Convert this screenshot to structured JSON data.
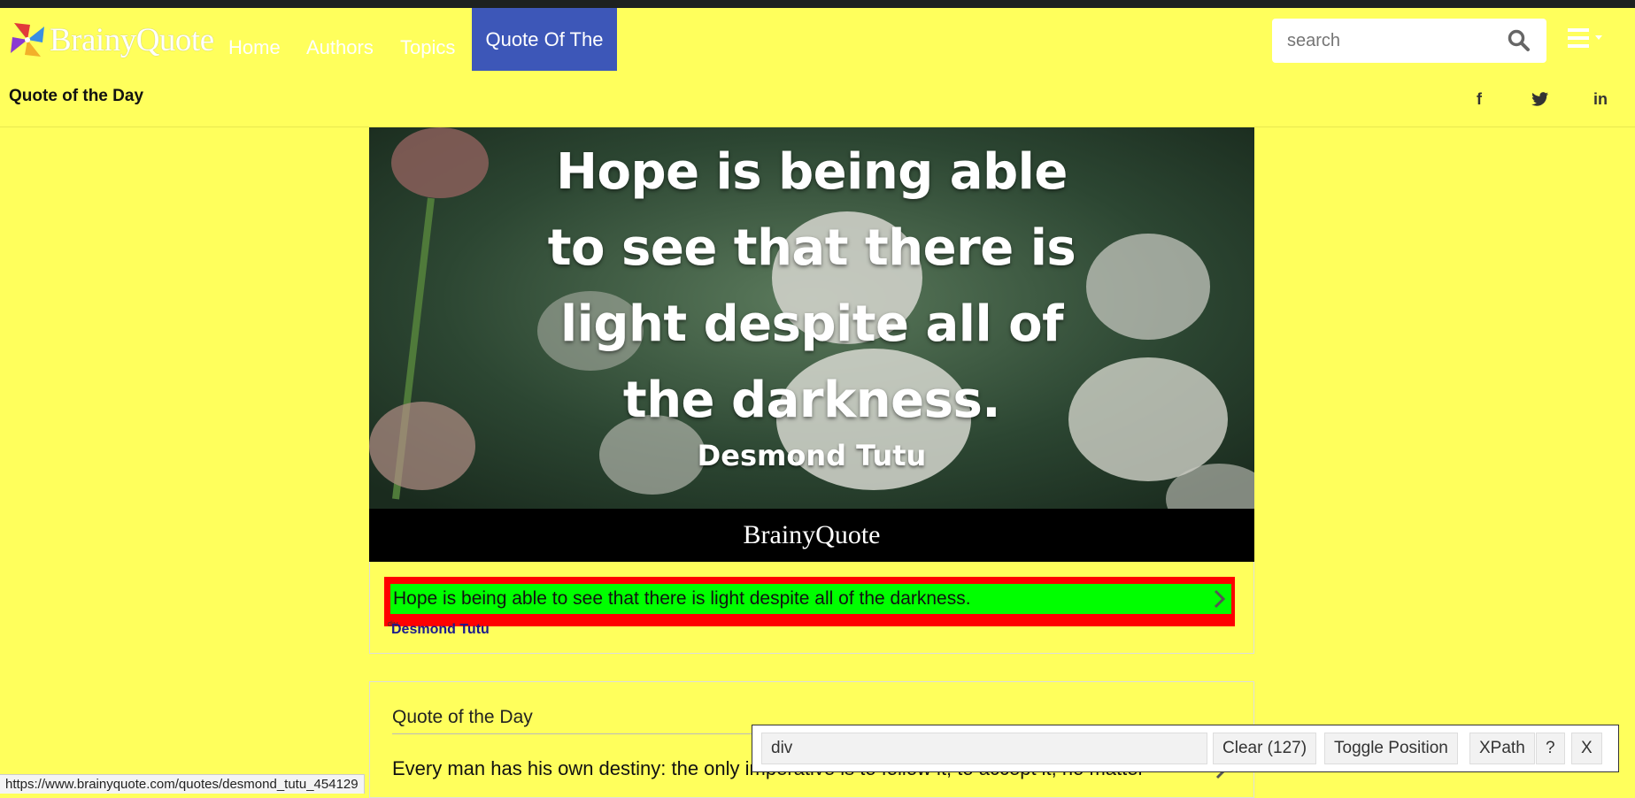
{
  "brand": {
    "logo_text": "BrainyQuote"
  },
  "nav": {
    "items": [
      {
        "label": "Home"
      },
      {
        "label": "Authors"
      },
      {
        "label": "Topics"
      },
      {
        "label": "Quote Of The Day",
        "active": true
      }
    ]
  },
  "search": {
    "placeholder": "search"
  },
  "subheader": {
    "title": "Quote of the Day",
    "social": {
      "facebook": "f",
      "linkedin": "in"
    }
  },
  "featured": {
    "image_lines": [
      "Hope is being able",
      "to see that there is",
      "light despite all of",
      "the darkness."
    ],
    "image_author": "Desmond Tutu",
    "image_brand": "BrainyQuote",
    "quote_text": "Hope is being able to see that there is light despite all of the darkness.",
    "author": "Desmond Tutu",
    "highlight_label": "div"
  },
  "second_card": {
    "title": "Quote of the Day",
    "quote_text": "Every man has his own destiny: the only imperative is to follow it, to accept it, no matter"
  },
  "devtools": {
    "selector_value": "div",
    "buttons": [
      "Clear (127)",
      "Toggle Position",
      "XPath",
      "?",
      "X"
    ]
  },
  "status_url": "https://www.brainyquote.com/quotes/desmond_tutu_454129",
  "colors": {
    "page_bg": "#ffff5c",
    "active_nav": "#3d57b8",
    "highlight_outer": "#ff0000",
    "highlight_inner": "#00ff00",
    "author_link": "#1a1a8c"
  }
}
